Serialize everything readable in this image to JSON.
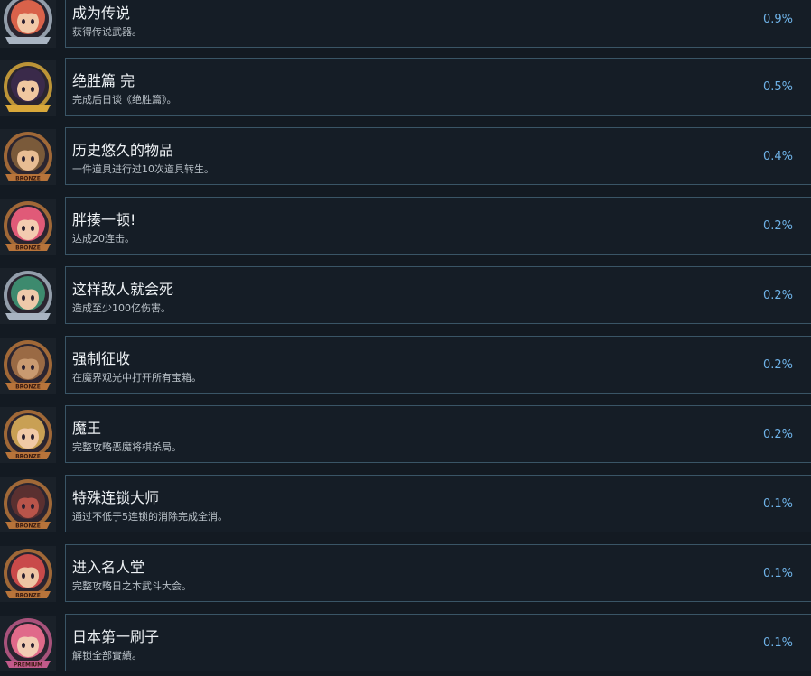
{
  "achievements": [
    {
      "title": "成为传说",
      "desc": "获得传说武器。",
      "pct": "0.9%",
      "icon": "silver-badge-red-hair-character-icon",
      "badge": "silver",
      "hair": "#d9624a",
      "skin": "#f1c9a8",
      "banner_text": ""
    },
    {
      "title": "绝胜篇 完",
      "desc": "完成后日谈《绝胜篇》。",
      "pct": "0.5%",
      "icon": "gold-badge-dark-hair-character-icon",
      "badge": "gold",
      "hair": "#3a2a4a",
      "skin": "#f0c7a0",
      "banner_text": ""
    },
    {
      "title": "历史悠久的物品",
      "desc": "一件道具进行过10次道具转生。",
      "pct": "0.4%",
      "icon": "bronze-badge-hat-character-icon",
      "badge": "bronze",
      "hair": "#7a5a3a",
      "skin": "#e8bd93",
      "banner_text": "BRONZE"
    },
    {
      "title": "胖揍一顿!",
      "desc": "达成20连击。",
      "pct": "0.2%",
      "icon": "bronze-badge-pink-hair-character-icon",
      "badge": "bronze",
      "hair": "#e05a78",
      "skin": "#f3cbb0",
      "banner_text": "BRONZE"
    },
    {
      "title": "这样敌人就会死",
      "desc": "造成至少100亿伤害。",
      "pct": "0.2%",
      "icon": "silver-badge-green-hair-character-icon",
      "badge": "silver",
      "hair": "#3d8a6e",
      "skin": "#eec9aa",
      "banner_text": ""
    },
    {
      "title": "强制征收",
      "desc": "在魔界观光中打开所有宝箱。",
      "pct": "0.2%",
      "icon": "bronze-badge-brown-mascot-icon",
      "badge": "bronze",
      "hair": "#9a6a44",
      "skin": "#c99a70",
      "banner_text": "BRONZE"
    },
    {
      "title": "魔王",
      "desc": "完整攻略恶魔将棋杀局。",
      "pct": "0.2%",
      "icon": "bronze-badge-blonde-character-icon",
      "badge": "bronze",
      "hair": "#c9a054",
      "skin": "#f0c9a6",
      "banner_text": "BRONZE"
    },
    {
      "title": "特殊连锁大师",
      "desc": "通过不低于5连锁的消除完成全消。",
      "pct": "0.1%",
      "icon": "bronze-badge-hooded-character-icon",
      "badge": "bronze",
      "hair": "#5a3030",
      "skin": "#b8544a",
      "banner_text": "BRONZE"
    },
    {
      "title": "进入名人堂",
      "desc": "完整攻略日之本武斗大会。",
      "pct": "0.1%",
      "icon": "bronze-badge-red-hair-character-icon",
      "badge": "bronze",
      "hair": "#c94a4a",
      "skin": "#eec6a4",
      "banner_text": "BRONZE"
    },
    {
      "title": "日本第一刷子",
      "desc": "解锁全部實績。",
      "pct": "0.1%",
      "icon": "premium-badge-character-icon",
      "badge": "premium",
      "hair": "#e06a8a",
      "skin": "#f2cdb4",
      "banner_text": "PREMIUM"
    }
  ],
  "colors": {
    "background": "#131a22",
    "panel": "#151d26",
    "panel_border": "#3a5566",
    "title": "#eef2f5",
    "description": "#b9c1c8",
    "percentage": "#6fb3e8",
    "bronze": "#b8743a",
    "silver": "#a9b4c2",
    "gold": "#d9a83a",
    "premium": "#c25a8a"
  }
}
